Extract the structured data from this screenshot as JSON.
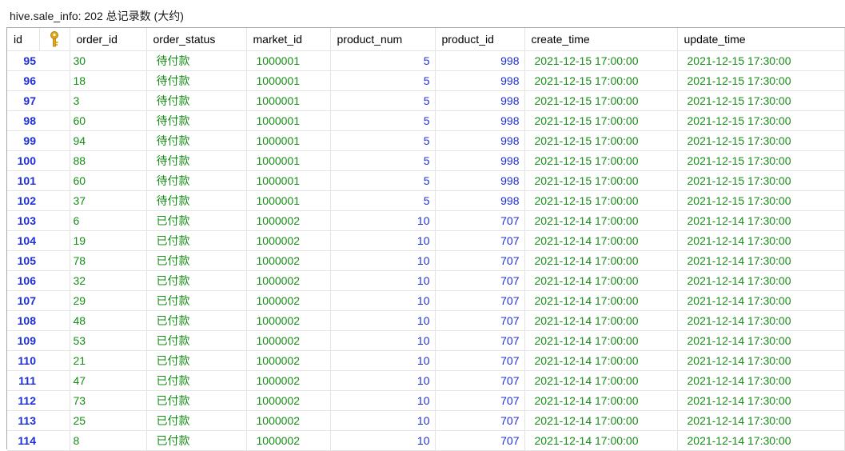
{
  "window": {
    "title": "hive.sale_info: 202 总记录数 (大约)"
  },
  "columns": {
    "id": "id",
    "key_icon": "key-icon",
    "order_id": "order_id",
    "order_status": "order_status",
    "market_id": "market_id",
    "product_num": "product_num",
    "product_id": "product_id",
    "create_time": "create_time",
    "update_time": "update_time"
  },
  "colors": {
    "number_blue": "#1f2fd6",
    "text_green": "#178d17",
    "key_gold": "#e0a81b"
  },
  "rows": [
    {
      "id": "95",
      "order_id": "30",
      "order_status": "待付款",
      "market_id": "1000001",
      "product_num": "5",
      "product_id": "998",
      "create_time": "2021-12-15 17:00:00",
      "update_time": "2021-12-15 17:30:00"
    },
    {
      "id": "96",
      "order_id": "18",
      "order_status": "待付款",
      "market_id": "1000001",
      "product_num": "5",
      "product_id": "998",
      "create_time": "2021-12-15 17:00:00",
      "update_time": "2021-12-15 17:30:00"
    },
    {
      "id": "97",
      "order_id": "3",
      "order_status": "待付款",
      "market_id": "1000001",
      "product_num": "5",
      "product_id": "998",
      "create_time": "2021-12-15 17:00:00",
      "update_time": "2021-12-15 17:30:00"
    },
    {
      "id": "98",
      "order_id": "60",
      "order_status": "待付款",
      "market_id": "1000001",
      "product_num": "5",
      "product_id": "998",
      "create_time": "2021-12-15 17:00:00",
      "update_time": "2021-12-15 17:30:00"
    },
    {
      "id": "99",
      "order_id": "94",
      "order_status": "待付款",
      "market_id": "1000001",
      "product_num": "5",
      "product_id": "998",
      "create_time": "2021-12-15 17:00:00",
      "update_time": "2021-12-15 17:30:00"
    },
    {
      "id": "100",
      "order_id": "88",
      "order_status": "待付款",
      "market_id": "1000001",
      "product_num": "5",
      "product_id": "998",
      "create_time": "2021-12-15 17:00:00",
      "update_time": "2021-12-15 17:30:00"
    },
    {
      "id": "101",
      "order_id": "60",
      "order_status": "待付款",
      "market_id": "1000001",
      "product_num": "5",
      "product_id": "998",
      "create_time": "2021-12-15 17:00:00",
      "update_time": "2021-12-15 17:30:00"
    },
    {
      "id": "102",
      "order_id": "37",
      "order_status": "待付款",
      "market_id": "1000001",
      "product_num": "5",
      "product_id": "998",
      "create_time": "2021-12-15 17:00:00",
      "update_time": "2021-12-15 17:30:00"
    },
    {
      "id": "103",
      "order_id": "6",
      "order_status": "已付款",
      "market_id": "1000002",
      "product_num": "10",
      "product_id": "707",
      "create_time": "2021-12-14 17:00:00",
      "update_time": "2021-12-14 17:30:00"
    },
    {
      "id": "104",
      "order_id": "19",
      "order_status": "已付款",
      "market_id": "1000002",
      "product_num": "10",
      "product_id": "707",
      "create_time": "2021-12-14 17:00:00",
      "update_time": "2021-12-14 17:30:00"
    },
    {
      "id": "105",
      "order_id": "78",
      "order_status": "已付款",
      "market_id": "1000002",
      "product_num": "10",
      "product_id": "707",
      "create_time": "2021-12-14 17:00:00",
      "update_time": "2021-12-14 17:30:00"
    },
    {
      "id": "106",
      "order_id": "32",
      "order_status": "已付款",
      "market_id": "1000002",
      "product_num": "10",
      "product_id": "707",
      "create_time": "2021-12-14 17:00:00",
      "update_time": "2021-12-14 17:30:00"
    },
    {
      "id": "107",
      "order_id": "29",
      "order_status": "已付款",
      "market_id": "1000002",
      "product_num": "10",
      "product_id": "707",
      "create_time": "2021-12-14 17:00:00",
      "update_time": "2021-12-14 17:30:00"
    },
    {
      "id": "108",
      "order_id": "48",
      "order_status": "已付款",
      "market_id": "1000002",
      "product_num": "10",
      "product_id": "707",
      "create_time": "2021-12-14 17:00:00",
      "update_time": "2021-12-14 17:30:00"
    },
    {
      "id": "109",
      "order_id": "53",
      "order_status": "已付款",
      "market_id": "1000002",
      "product_num": "10",
      "product_id": "707",
      "create_time": "2021-12-14 17:00:00",
      "update_time": "2021-12-14 17:30:00"
    },
    {
      "id": "110",
      "order_id": "21",
      "order_status": "已付款",
      "market_id": "1000002",
      "product_num": "10",
      "product_id": "707",
      "create_time": "2021-12-14 17:00:00",
      "update_time": "2021-12-14 17:30:00"
    },
    {
      "id": "111",
      "order_id": "47",
      "order_status": "已付款",
      "market_id": "1000002",
      "product_num": "10",
      "product_id": "707",
      "create_time": "2021-12-14 17:00:00",
      "update_time": "2021-12-14 17:30:00"
    },
    {
      "id": "112",
      "order_id": "73",
      "order_status": "已付款",
      "market_id": "1000002",
      "product_num": "10",
      "product_id": "707",
      "create_time": "2021-12-14 17:00:00",
      "update_time": "2021-12-14 17:30:00"
    },
    {
      "id": "113",
      "order_id": "25",
      "order_status": "已付款",
      "market_id": "1000002",
      "product_num": "10",
      "product_id": "707",
      "create_time": "2021-12-14 17:00:00",
      "update_time": "2021-12-14 17:30:00"
    },
    {
      "id": "114",
      "order_id": "8",
      "order_status": "已付款",
      "market_id": "1000002",
      "product_num": "10",
      "product_id": "707",
      "create_time": "2021-12-14 17:00:00",
      "update_time": "2021-12-14 17:30:00"
    }
  ]
}
